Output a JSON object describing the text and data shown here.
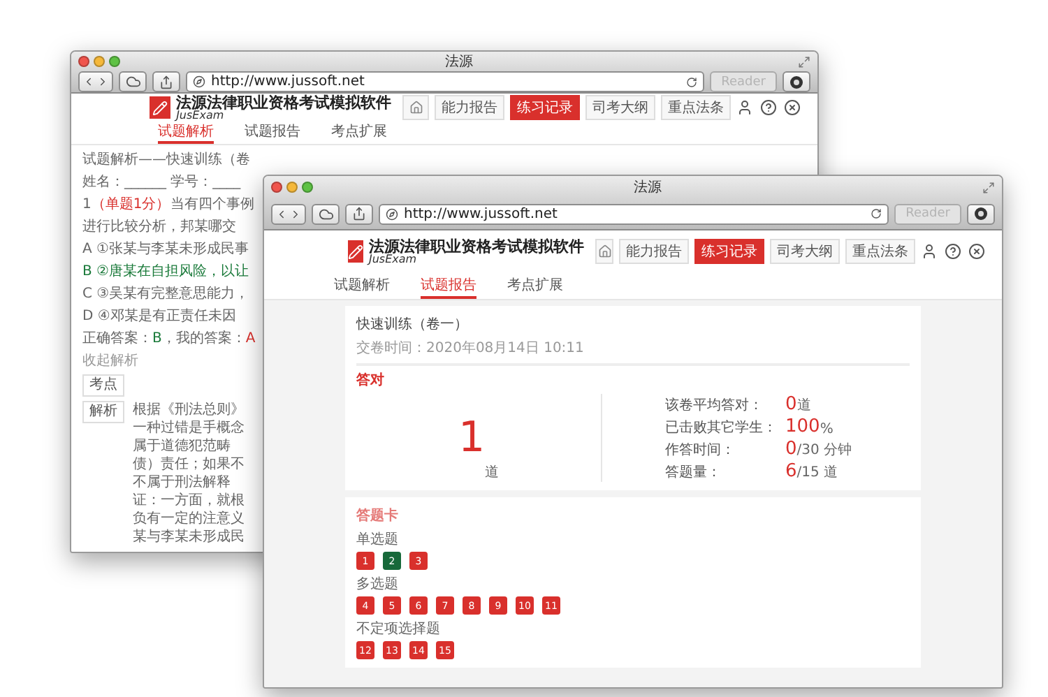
{
  "back_window": {
    "title": "法源",
    "url": "http://www.jussoft.net",
    "reader": "Reader",
    "brand": {
      "title": "法源法律职业资格考试模拟软件",
      "subtitle": "JusExam"
    },
    "nav": [
      {
        "label": "能力报告",
        "selected": false
      },
      {
        "label": "练习记录",
        "selected": true
      },
      {
        "label": "司考大纲",
        "selected": false
      },
      {
        "label": "重点法条",
        "selected": false
      }
    ],
    "tabs": [
      {
        "label": "试题解析",
        "selected": true
      },
      {
        "label": "试题报告",
        "selected": false
      },
      {
        "label": "考点扩展",
        "selected": false
      }
    ],
    "analysis": {
      "heading": "试题解析——快速训练（卷",
      "student": "姓名：______ 学号：____",
      "question": {
        "number": "1",
        "score": "（单题1分）",
        "lines": [
          "当有四个事例",
          "进行比较分析，邦某哪交"
        ]
      },
      "options": [
        {
          "text": "A ①张某与李某未形成民事",
          "correct": false
        },
        {
          "text": "B ②唐某在自担风险，以让",
          "correct": true
        },
        {
          "text": "C ③吴某有完整意思能力，",
          "correct": false
        },
        {
          "text": "D ④邓某是有正责任未因",
          "correct": false
        }
      ],
      "answer": {
        "label": "正确答案：",
        "correct": "B",
        "mine_label": "，我的答案：",
        "mine": "A"
      },
      "toggle": "收起解析",
      "point_button": "考点",
      "explain_button": "解析",
      "explanation": [
        "根据《刑法总则》",
        "一种过错是手概念",
        "属于道德犯范畴",
        "债）责任；如果不",
        "不属于刑法解释",
        "证：一方面，就根",
        "负有一定的注意义",
        "某与李某未形成民"
      ]
    }
  },
  "front_window": {
    "title": "法源",
    "url": "http://www.jussoft.net",
    "reader": "Reader",
    "brand": {
      "title": "法源法律职业资格考试模拟软件",
      "subtitle": "JusExam"
    },
    "nav": [
      {
        "label": "能力报告",
        "selected": false
      },
      {
        "label": "练习记录",
        "selected": true
      },
      {
        "label": "司考大纲",
        "selected": false
      },
      {
        "label": "重点法条",
        "selected": false
      }
    ],
    "tabs": [
      {
        "label": "试题解析",
        "selected": false
      },
      {
        "label": "试题报告",
        "selected": true
      },
      {
        "label": "考点扩展",
        "selected": false
      }
    ],
    "report": {
      "title": "快速训练（卷一）",
      "submitted": "交卷时间：2020年08月14日 10:11",
      "correct_label": "答对",
      "correct_count": "1",
      "correct_unit": "道",
      "stats": [
        {
          "label": "该卷平均答对：",
          "value": "0",
          "unit": "道"
        },
        {
          "label": "已击败其它学生：",
          "value": "100",
          "unit": "%"
        },
        {
          "label": "作答时间：",
          "value": "0",
          "unit": "/30 分钟"
        },
        {
          "label": "答题量：",
          "value": "6",
          "unit": "/15 道"
        }
      ]
    },
    "answer_card": {
      "title": "答题卡",
      "groups": [
        {
          "label": "单选题",
          "items": [
            {
              "label": "1",
              "correct": false
            },
            {
              "label": "2",
              "correct": true
            },
            {
              "label": "3",
              "correct": false
            }
          ]
        },
        {
          "label": "多选题",
          "items": [
            {
              "label": "4",
              "correct": false
            },
            {
              "label": "5",
              "correct": false
            },
            {
              "label": "6",
              "correct": false
            },
            {
              "label": "7",
              "correct": false
            },
            {
              "label": "8",
              "correct": false
            },
            {
              "label": "9",
              "correct": false
            },
            {
              "label": "10",
              "correct": false
            },
            {
              "label": "11",
              "correct": false
            }
          ]
        },
        {
          "label": "不定项选择题",
          "items": [
            {
              "label": "12",
              "correct": false
            },
            {
              "label": "13",
              "correct": false
            },
            {
              "label": "14",
              "correct": false
            },
            {
              "label": "15",
              "correct": false
            }
          ]
        }
      ]
    }
  }
}
